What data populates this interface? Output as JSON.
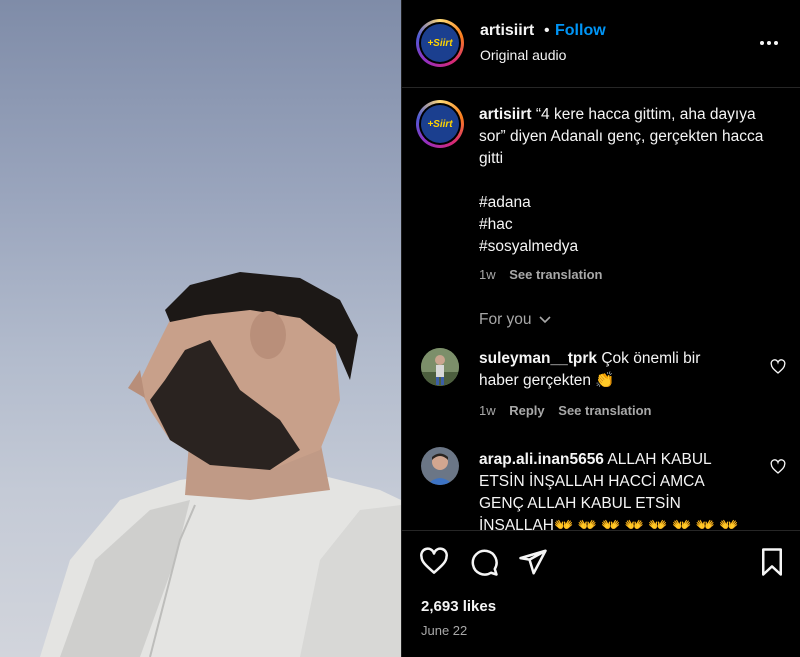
{
  "post": {
    "username": "artisiirt",
    "follow_label": "Follow",
    "separator": "•",
    "audio_label": "Original audio",
    "avatar_logo_text": "+Siirt"
  },
  "caption": {
    "username": "artisiirt",
    "text": "“4 kere hacca gittim, aha dayıya sor” diyen Adanalı genç, gerçekten hacca gitti",
    "hashtags": [
      "#adana",
      "#hac",
      "#sosyalmedya"
    ],
    "time": "1w",
    "see_translation": "See translation"
  },
  "for_you_label": "For you",
  "comments": [
    {
      "username": "suleyman__tprk",
      "text": "Çok önemli bir haber gerçekten 👏",
      "time": "1w",
      "reply": "Reply",
      "see_translation": "See translation"
    },
    {
      "username": "arap.ali.inan5656",
      "text": "ALLAH KABUL ETSİN İNŞALLAH HACCİ AMCA GENÇ ALLAH KABUL ETSİN İNSALLAH👐 👐 👐 👐 👐 👐 👐 👐"
    }
  ],
  "footer": {
    "likes": "2,693 likes",
    "date": "June 22"
  },
  "icons": {
    "more": "more-icon",
    "heart": "heart-icon",
    "comment": "comment-icon",
    "share": "share-icon",
    "save": "bookmark-icon"
  },
  "colors": {
    "follow": "#0095f6",
    "muted": "#a8a8a8",
    "background": "#000000"
  }
}
